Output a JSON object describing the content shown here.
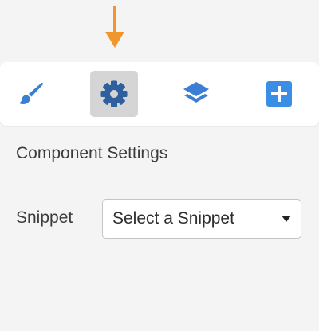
{
  "annotation": {
    "pointer_icon": "down-arrow-icon",
    "pointer_color": "#f0962d"
  },
  "toolbar": {
    "active_tab": "settings",
    "items": [
      {
        "key": "style",
        "icon": "paintbrush-icon",
        "color": "#3b7fd4"
      },
      {
        "key": "settings",
        "icon": "gear-icon",
        "color": "#2f5f9e"
      },
      {
        "key": "layers",
        "icon": "layers-icon",
        "color": "#3b7fd4"
      },
      {
        "key": "add",
        "icon": "plus-square-icon",
        "color": "#3b8ee6"
      }
    ]
  },
  "panel": {
    "title": "Component Settings",
    "snippet_label": "Snippet",
    "snippet_select": {
      "value": "Select a Snippet",
      "icon": "caret-down-icon"
    }
  },
  "colors": {
    "background": "#f4f4f4",
    "toolbar_bg": "#ffffff",
    "active_tab_bg": "#d5d5d5",
    "text": "#3c3c3c"
  }
}
